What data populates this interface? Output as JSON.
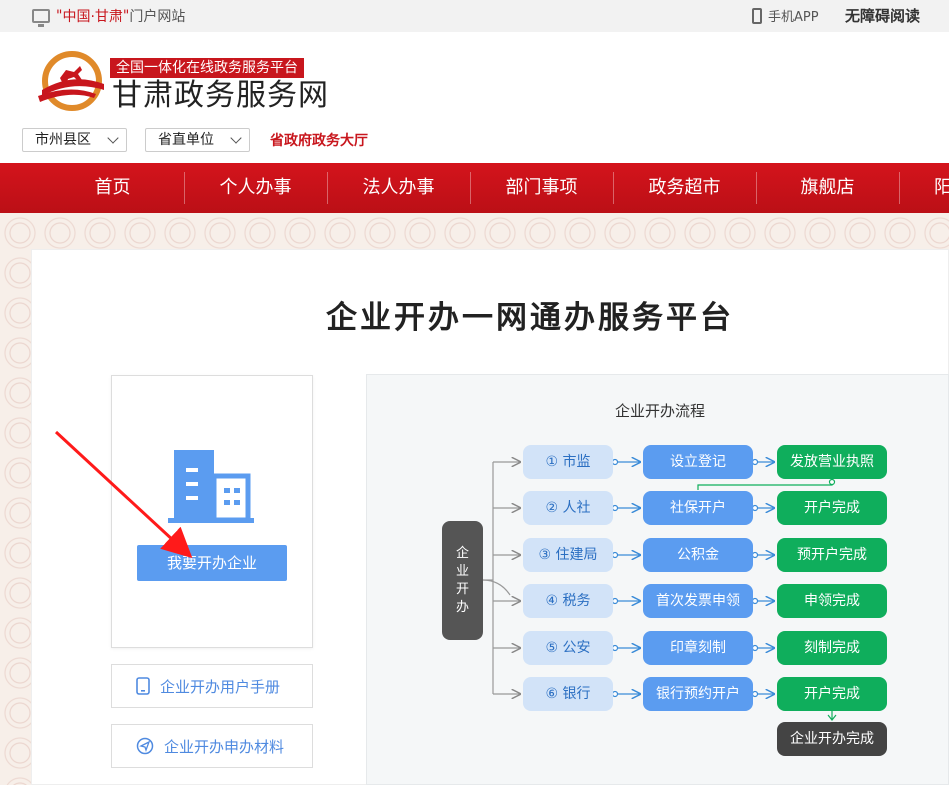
{
  "topbar": {
    "quote_open": "\"",
    "portal_name": "中国·甘肃",
    "quote_close": "\"",
    "portal_suffix": "门户网站",
    "mobile_app": "手机APP",
    "accessible_reading": "无障碍阅读"
  },
  "header": {
    "slogan": "全国一体化在线政务服务平台",
    "site_name": "甘肃政务服务网",
    "select_city": "市州县区",
    "select_dept": "省直单位",
    "hall_link": "省政府政务大厅"
  },
  "nav": {
    "items": [
      "首页",
      "个人办事",
      "法人办事",
      "部门事项",
      "政务超市",
      "旗舰店",
      "阳"
    ]
  },
  "main": {
    "title": "企业开办一网通办服务平台",
    "open_button": "我要开办企业",
    "manual_link": "企业开办用户手册",
    "materials_link": "企业开办申办材料"
  },
  "flow": {
    "title": "企业开办流程",
    "start_chars": [
      "企",
      "业",
      "开",
      "办"
    ],
    "rows": [
      {
        "dept": "① 市监",
        "step": "设立登记",
        "done": "发放营业执照"
      },
      {
        "dept": "② 人社",
        "step": "社保开户",
        "done": "开户完成"
      },
      {
        "dept": "③ 住建局",
        "step": "公积金",
        "done": "预开户完成"
      },
      {
        "dept": "④ 税务",
        "step": "首次发票申领",
        "done": "申领完成"
      },
      {
        "dept": "⑤ 公安",
        "step": "印章刻制",
        "done": "刻制完成"
      },
      {
        "dept": "⑥ 银行",
        "step": "银行预约开户",
        "done": "开户完成"
      }
    ],
    "final": "企业开办完成"
  },
  "colors": {
    "brand_red": "#c8161d",
    "accent_blue": "#5b9cf0",
    "done_green": "#0fae5c",
    "annotation_arrow": "#ff1a1a"
  }
}
